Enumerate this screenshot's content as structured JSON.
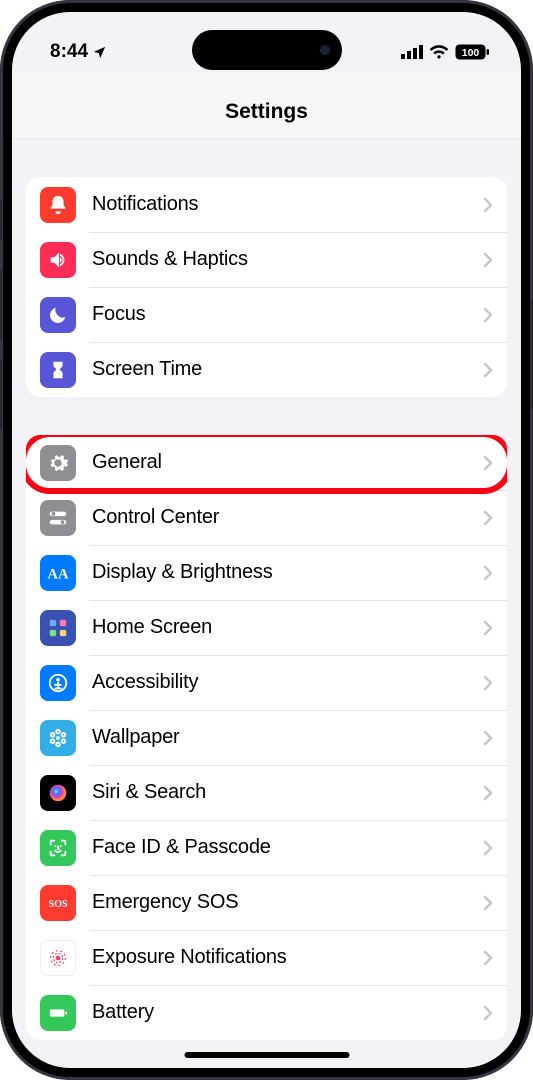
{
  "statusbar": {
    "time": "8:44",
    "battery": "100"
  },
  "header": {
    "title": "Settings"
  },
  "groups": [
    {
      "rows": [
        {
          "id": "notifications",
          "label": "Notifications",
          "icon": "bell",
          "bg": "bg-red"
        },
        {
          "id": "sounds",
          "label": "Sounds & Haptics",
          "icon": "speaker",
          "bg": "bg-pink"
        },
        {
          "id": "focus",
          "label": "Focus",
          "icon": "moon",
          "bg": "bg-indigo"
        },
        {
          "id": "screentime",
          "label": "Screen Time",
          "icon": "hourglass",
          "bg": "bg-indigo"
        }
      ]
    },
    {
      "rows": [
        {
          "id": "general",
          "label": "General",
          "icon": "gear",
          "bg": "bg-gray",
          "highlighted": true
        },
        {
          "id": "controlcenter",
          "label": "Control Center",
          "icon": "switches",
          "bg": "bg-gray"
        },
        {
          "id": "display",
          "label": "Display & Brightness",
          "icon": "aa",
          "bg": "bg-blue"
        },
        {
          "id": "homescreen",
          "label": "Home Screen",
          "icon": "grid",
          "bg": "bg-home"
        },
        {
          "id": "accessibility",
          "label": "Accessibility",
          "icon": "person",
          "bg": "bg-blue"
        },
        {
          "id": "wallpaper",
          "label": "Wallpaper",
          "icon": "flower",
          "bg": "bg-cyan"
        },
        {
          "id": "siri",
          "label": "Siri & Search",
          "icon": "siri",
          "bg": "bg-black"
        },
        {
          "id": "faceid",
          "label": "Face ID & Passcode",
          "icon": "face",
          "bg": "bg-green"
        },
        {
          "id": "sos",
          "label": "Emergency SOS",
          "icon": "sos",
          "bg": "bg-red"
        },
        {
          "id": "exposure",
          "label": "Exposure Notifications",
          "icon": "virus",
          "bg": "bg-white"
        },
        {
          "id": "battery",
          "label": "Battery",
          "icon": "battery",
          "bg": "bg-green"
        }
      ]
    }
  ]
}
